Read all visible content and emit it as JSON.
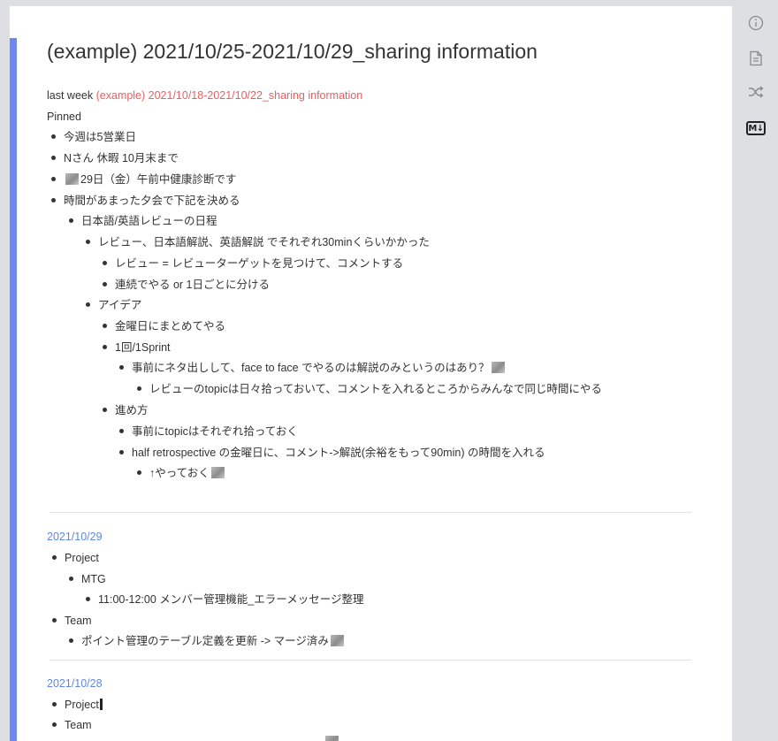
{
  "note": {
    "title": "(example) 2021/10/25-2021/10/29_sharing information",
    "last_week_label": "last week",
    "last_week_link": "(example) 2021/10/18-2021/10/22_sharing information",
    "pinned_label": "Pinned"
  },
  "pinned_items": [
    "今週は5営業日",
    "Nさん 休暇 10月末まで",
    "29日（金）午前中健康診断です",
    "時間があまった夕会で下記を決める",
    "日本語/英語レビューの日程",
    "レビュー、日本語解説、英語解説 でそれぞれ30minくらいかかった",
    "レビュー = レビューターゲットを見つけて、コメントする",
    "連続でやる or 1日ごとに分ける",
    "アイデア",
    "金曜日にまとめてやる",
    "1回/1Sprint",
    "事前にネタ出しして、face to face でやるのは解説のみというのはあり？",
    "レビューのtopicは日々拾っておいて、コメントを入れるところからみんなで同じ時間にやる",
    "進め方",
    "事前にtopicはそれぞれ拾っておく",
    "half retrospective の金曜日に、コメント->解説(余裕をもって90min) の時間を入れる",
    "↑やっておく"
  ],
  "section_1029": {
    "date": "2021/10/29",
    "items": [
      "Project",
      "MTG",
      "11:00-12:00 メンバー管理機能_エラーメッセージ整理",
      "Team",
      "ポイント管理のテーブル定義を更新 -> マージ済み"
    ]
  },
  "section_1028": {
    "date": "2021/10/28",
    "items": [
      "Project",
      "Team"
    ]
  },
  "sidebar": {
    "info_icon": "info-icon",
    "document_icon": "document-icon",
    "shuffle_icon": "shuffle-icon",
    "markdown_label": "M↓"
  },
  "colors": {
    "accent_bar": "#6f87f2",
    "link": "#ee5d5d",
    "date": "#5f86e8"
  }
}
